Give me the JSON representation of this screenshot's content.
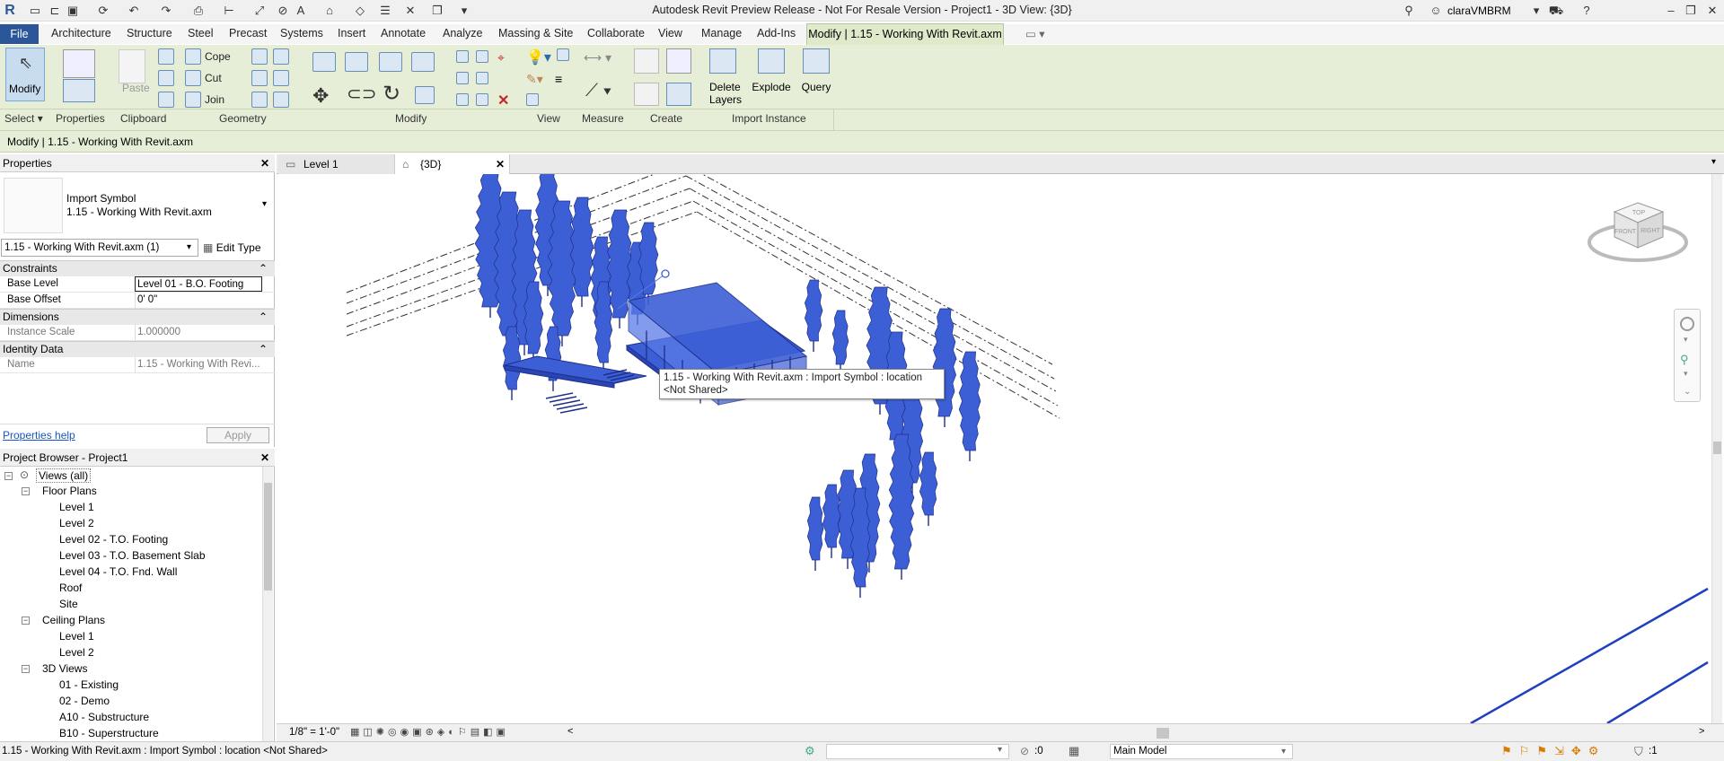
{
  "window": {
    "title": "Autodesk Revit Preview Release - Not For Resale Version - Project1 - 3D View: {3D}",
    "user": "claraVMBRM"
  },
  "menu": {
    "file": "File",
    "tabs": [
      "Architecture",
      "Structure",
      "Steel",
      "Precast",
      "Systems",
      "Insert",
      "Annotate",
      "Analyze",
      "Massing & Site",
      "Collaborate",
      "View",
      "Manage",
      "Add-Ins"
    ],
    "active_tab": "Modify | 1.15 - Working With Revit.axm"
  },
  "ribbon": {
    "select_label": "Select",
    "modify_label": "Modify",
    "properties_label": "Properties",
    "paste_label": "Paste",
    "clipboard_label": "Clipboard",
    "cope_label": "Cope",
    "cut_label": "Cut",
    "join_label": "Join",
    "geometry_label": "Geometry",
    "modify_group_label": "Modify",
    "view_label": "View",
    "measure_label": "Measure",
    "create_label": "Create",
    "delete_layers_label_1": "Delete",
    "delete_layers_label_2": "Layers",
    "explode_label": "Explode",
    "query_label": "Query",
    "import_instance_label": "Import Instance"
  },
  "context_bar": "Modify | 1.15 - Working With Revit.axm",
  "properties": {
    "title": "Properties",
    "type_line1": "Import Symbol",
    "type_line2": "1.15 - Working With Revit.axm",
    "selector": "1.15 - Working With Revit.axm (1)",
    "edit_type": "Edit Type",
    "sections": {
      "constraints": "Constraints",
      "dimensions": "Dimensions",
      "identity": "Identity Data"
    },
    "rows": {
      "base_level_k": "Base Level",
      "base_level_v": "Level 01 - B.O. Footing",
      "base_offset_k": "Base Offset",
      "base_offset_v": "0'  0\"",
      "instance_scale_k": "Instance Scale",
      "instance_scale_v": "1.000000",
      "name_k": "Name",
      "name_v": "1.15 - Working With Revi..."
    },
    "help": "Properties help",
    "apply": "Apply"
  },
  "browser": {
    "title": "Project Browser - Project1",
    "root": "Views (all)",
    "floor_plans": "Floor Plans",
    "fp_items": [
      "Level 1",
      "Level 2",
      "Level 02 - T.O. Footing",
      "Level 03 - T.O. Basement Slab",
      "Level 04 - T.O. Fnd. Wall",
      "Roof",
      "Site"
    ],
    "ceiling_plans": "Ceiling Plans",
    "cp_items": [
      "Level 1",
      "Level 2"
    ],
    "views_3d": "3D Views",
    "v3_items": [
      "01 - Existing",
      "02 - Demo",
      "A10 - Substructure",
      "B10 - Superstructure"
    ]
  },
  "view_tabs": {
    "tab1": "Level 1",
    "tab2": "{3D}"
  },
  "viewport": {
    "tooltip_line1": "1.15 - Working With Revit.axm : Import Symbol : location",
    "tooltip_line2": "<Not Shared>",
    "viewcube_top": "TOP",
    "viewcube_front": "FRONT",
    "viewcube_right": "RIGHT",
    "selection_color": "#3d5fd6"
  },
  "view_control": {
    "scale": "1/8\" = 1'-0\""
  },
  "status": {
    "text": "1.15 - Working With Revit.axm : Import Symbol : location <Not Shared>",
    "coord": ":0",
    "model": "Main Model",
    "filter": ":1"
  }
}
